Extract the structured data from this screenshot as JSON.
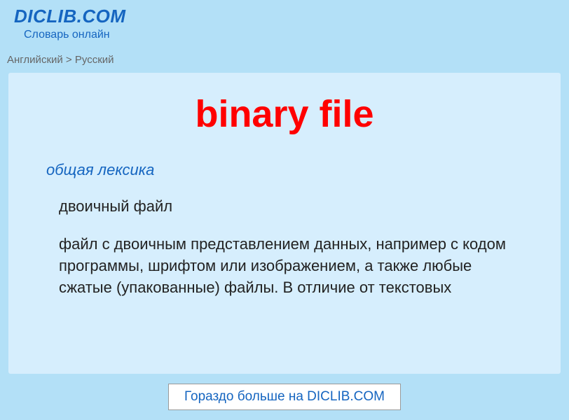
{
  "header": {
    "logo": "DICLIB.COM",
    "subtitle": "Словарь онлайн"
  },
  "breadcrumb": "Английский > Русский",
  "term": {
    "title": "binary file",
    "category": "общая лексика",
    "definition_short": "двоичный файл",
    "definition_long": "файл с двоичным представлением данных, например с кодом программы, шрифтом или изображением, а также любые сжатые (упакованные) файлы. В отличие от текстовых"
  },
  "more_link": "Гораздо больше на DICLIB.COM"
}
